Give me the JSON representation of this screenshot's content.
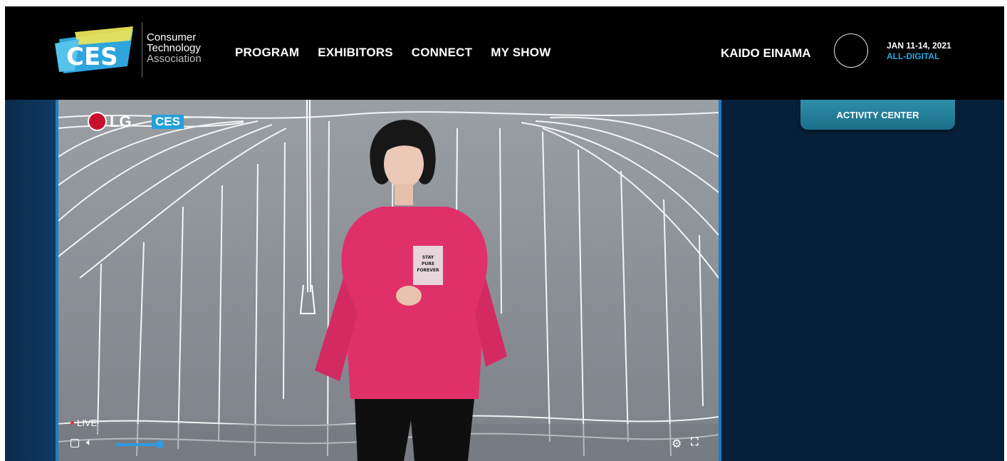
{
  "header": {
    "logo_text": "CES",
    "org_line1": "Consumer",
    "org_line2": "Technology",
    "org_line3": "Association",
    "nav": [
      "PROGRAM",
      "EXHIBITORS",
      "CONNECT",
      "MY SHOW"
    ],
    "user_name": "KAIDO EINAMA",
    "event_date": "JAN 11-14, 2021",
    "event_format": "ALL-DIGITAL"
  },
  "sidebar": {
    "activity_button": "ACTIVITY CENTER"
  },
  "video": {
    "sponsor_logo": "LG",
    "event_logo": "CES",
    "hoodie_text": "STAY PURE FOREVER",
    "live_label": "LIVE",
    "volume_level": 0.8
  },
  "icons": [
    "stop-icon",
    "volume-icon",
    "settings-icon",
    "fullscreen-icon"
  ],
  "colors": {
    "background": "#06203a",
    "header": "#000000",
    "accent_blue": "#27a6e8",
    "button_teal": "#2d8fa8",
    "live_red": "#e03333"
  }
}
